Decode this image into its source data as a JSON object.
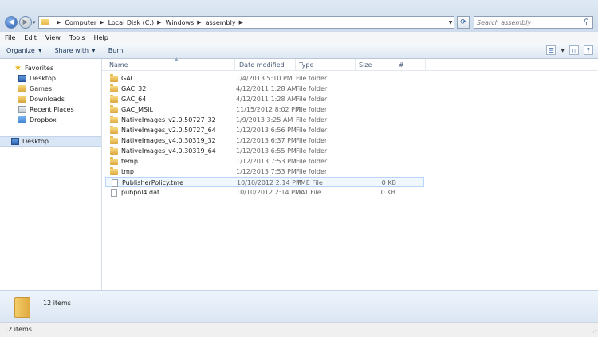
{
  "address": {
    "crumbs": [
      "Computer",
      "Local Disk (C:)",
      "Windows",
      "assembly"
    ],
    "refresh_icon": "refresh-icon"
  },
  "search": {
    "placeholder": "Search assembly"
  },
  "menu": [
    "File",
    "Edit",
    "View",
    "Tools",
    "Help"
  ],
  "toolbar": {
    "organize": "Organize",
    "share": "Share with",
    "burn": "Burn"
  },
  "nav": {
    "favorites": "Favorites",
    "items": [
      "Desktop",
      "Games",
      "Downloads",
      "Recent Places",
      "Dropbox"
    ],
    "desktop_root": "Desktop"
  },
  "columns": {
    "name": "Name",
    "date": "Date modified",
    "type": "Type",
    "size": "Size",
    "hash": "#"
  },
  "files": [
    {
      "name": "GAC",
      "date": "1/4/2013 5:10 PM",
      "type": "File folder",
      "size": "",
      "kind": "folder"
    },
    {
      "name": "GAC_32",
      "date": "4/12/2011 1:28 AM",
      "type": "File folder",
      "size": "",
      "kind": "folder"
    },
    {
      "name": "GAC_64",
      "date": "4/12/2011 1:28 AM",
      "type": "File folder",
      "size": "",
      "kind": "folder"
    },
    {
      "name": "GAC_MSIL",
      "date": "11/15/2012 8:02 PM",
      "type": "File folder",
      "size": "",
      "kind": "folder"
    },
    {
      "name": "NativeImages_v2.0.50727_32",
      "date": "1/9/2013 3:25 AM",
      "type": "File folder",
      "size": "",
      "kind": "folder"
    },
    {
      "name": "NativeImages_v2.0.50727_64",
      "date": "1/12/2013 6:56 PM",
      "type": "File folder",
      "size": "",
      "kind": "folder"
    },
    {
      "name": "NativeImages_v4.0.30319_32",
      "date": "1/12/2013 6:37 PM",
      "type": "File folder",
      "size": "",
      "kind": "folder"
    },
    {
      "name": "NativeImages_v4.0.30319_64",
      "date": "1/12/2013 6:55 PM",
      "type": "File folder",
      "size": "",
      "kind": "folder"
    },
    {
      "name": "temp",
      "date": "1/12/2013 7:53 PM",
      "type": "File folder",
      "size": "",
      "kind": "folder"
    },
    {
      "name": "tmp",
      "date": "1/12/2013 7:53 PM",
      "type": "File folder",
      "size": "",
      "kind": "folder"
    },
    {
      "name": "PublisherPolicy.tme",
      "date": "10/10/2012 2:14 PM",
      "type": "TME File",
      "size": "0 KB",
      "kind": "file"
    },
    {
      "name": "pubpol4.dat",
      "date": "10/10/2012 2:14 PM",
      "type": "DAT File",
      "size": "0 KB",
      "kind": "file"
    }
  ],
  "details": {
    "count": "12 items"
  },
  "status": {
    "count": "12 items"
  }
}
